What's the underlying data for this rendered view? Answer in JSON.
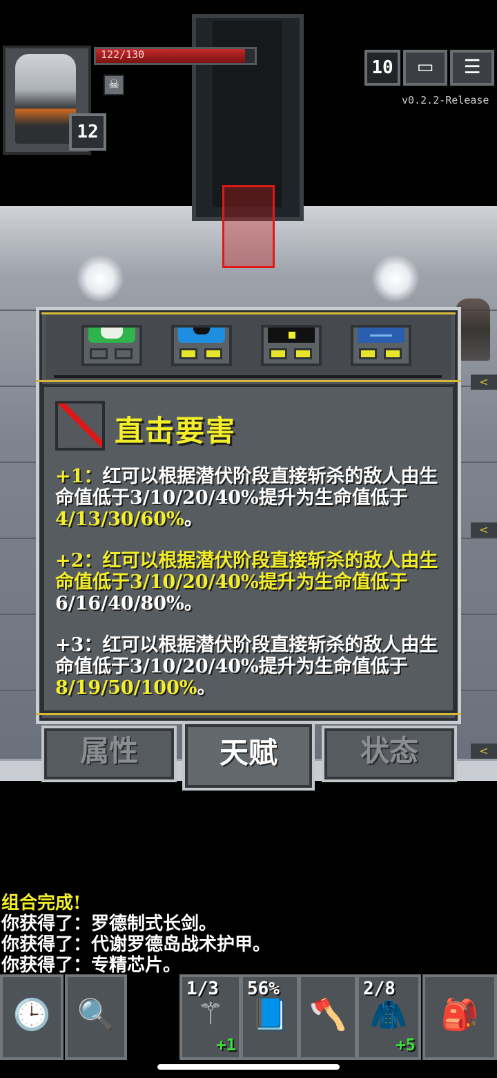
{
  "hud": {
    "hp_text": "122/130",
    "hp_fraction": 0.938,
    "level": "12",
    "depth": "10",
    "version": "v0.2.2-Release",
    "journal_icon": "journal-icon",
    "menu_icon": "menu-icon",
    "buff_icon": "skull-icon"
  },
  "equipment": {
    "items": [
      {
        "name": "armor-green-icon",
        "color": "#2fb34a",
        "slots": [
          false,
          false
        ]
      },
      {
        "name": "armor-blue-icon",
        "color": "#1e8fe0",
        "slots": [
          true,
          true
        ]
      },
      {
        "name": "armor-black-icon",
        "color": "#111111",
        "slots": [
          true,
          true
        ]
      },
      {
        "name": "armor-navy-icon",
        "color": "#2a5fb0",
        "slots": [
          true,
          true
        ]
      }
    ]
  },
  "talent": {
    "title": "直击要害",
    "icon": "red-slash-icon",
    "levels": [
      {
        "prefix": "+1：",
        "text": "红可以根据潜伏阶段直接斩杀的敌人由生命值低于3/10/20/40%提升为生命值低于",
        "values": "4/13/30/60%",
        "suffix": "。"
      },
      {
        "prefix": "+2：",
        "text": "红可以根据潜伏阶段直接斩杀的敌人由生命值低于3/10/20/40%提升为生命值低于",
        "values": "6/16/40/80%",
        "suffix": "。"
      },
      {
        "prefix": "+3：",
        "text": "红可以根据潜伏阶段直接斩杀的敌人由生命值低于3/10/20/40%提升为生命值低于",
        "values": "8/19/50/100%",
        "suffix": "。"
      }
    ]
  },
  "tabs": [
    "属性",
    "天赋",
    "状态"
  ],
  "log": [
    "组合完成!",
    "你获得了：罗德制式长剑。",
    "你获得了：代谢罗德岛战术护甲。",
    "你获得了：专精芯片。"
  ],
  "toolbar": {
    "wait_icon": "clock-icon",
    "search_icon": "magnifier-icon",
    "quickslots": [
      {
        "label": "1/3",
        "bonus": "+1",
        "icon": "wand-icon"
      },
      {
        "label": "56%",
        "bonus": "",
        "icon": "book-icon"
      },
      {
        "label": "",
        "bonus": "",
        "icon": "axe-icon"
      },
      {
        "label": "2/8",
        "bonus": "+5",
        "icon": "cloak-icon"
      }
    ],
    "backpack_icon": "backpack-icon"
  },
  "colors": {
    "accent_yellow": "#f3ee2a",
    "hp_red": "#c42a2a",
    "panel_gray": "#575c60",
    "bonus_green": "#39e03a"
  }
}
